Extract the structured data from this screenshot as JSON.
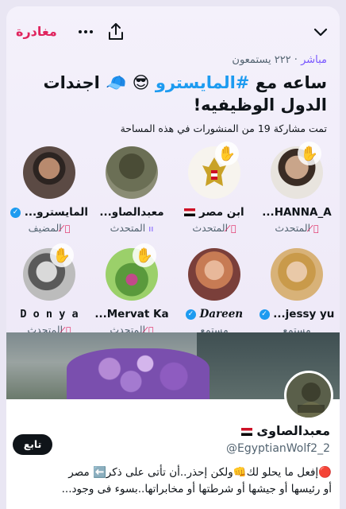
{
  "header": {
    "leave_label": "مغادرة"
  },
  "space": {
    "status_live": "مباشر",
    "listeners": "· ٢٢٢ يستمعون",
    "title_part1": "ساعه مع ",
    "title_hashtag": "#المايسترو",
    "title_part2": " 😎 🧢 اجندات الدول الوظيفيه!",
    "shared_posts": "تمت مشاركة 19 من المنشورات في هذه المساحة"
  },
  "participants": [
    {
      "name": "المايسترو...",
      "role": "المضيف",
      "verified": true,
      "flag": false,
      "hand": false
    },
    {
      "name": "معبدالصاو...",
      "role": "المتحدث",
      "verified": false,
      "flag": false,
      "hand": false
    },
    {
      "name": "ابن مصر",
      "role": "المتحدث",
      "verified": false,
      "flag": true,
      "hand": true
    },
    {
      "name": "HANNA_A...",
      "role": "المتحدث",
      "verified": false,
      "flag": false,
      "hand": true
    },
    {
      "name": "D o n y a",
      "role": "المتحدث",
      "verified": false,
      "flag": false,
      "hand": true
    },
    {
      "name": "Mervat Ka...",
      "role": "المتحدث",
      "verified": false,
      "flag": false,
      "hand": true
    },
    {
      "name": "Dareen",
      "role": "مستمع",
      "verified": true,
      "flag": false,
      "hand": false
    },
    {
      "name": "jessy yu...",
      "role": "مستمع",
      "verified": true,
      "flag": false,
      "hand": false
    }
  ],
  "profile_card": {
    "follow_label": "تابع",
    "name": "معبدالصاوى",
    "handle": "@EgyptianWolf2_2",
    "bio_line1": "🔴إفعل ما يحلو لك👊ولكن إحذر..أن تأتى على ذكر⬅️ مصر",
    "bio_line2": "أو رئيسها أو جيشها أو شرطتها أو مخابراتها..بسوء فى وجود..."
  },
  "colors": {
    "accent_red": "#e0245e",
    "accent_blue": "#1d9bf0",
    "live_purple": "#7856ff"
  }
}
